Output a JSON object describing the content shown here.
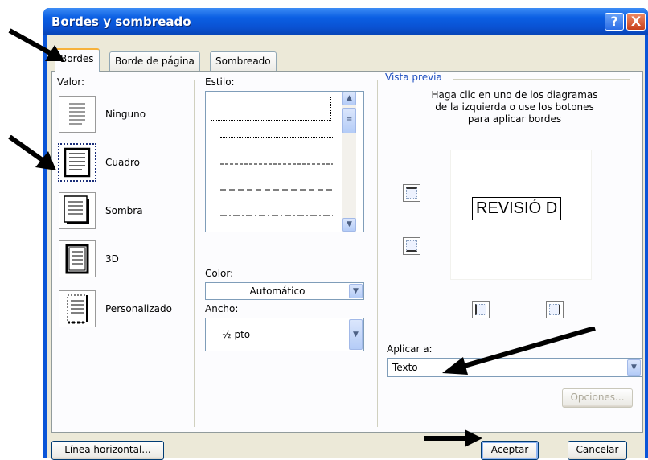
{
  "window": {
    "title": "Bordes y sombreado",
    "help_glyph": "?",
    "close_glyph": "X"
  },
  "tabs": [
    {
      "label": "Bordes",
      "active": true
    },
    {
      "label": "Borde de página",
      "active": false
    },
    {
      "label": "Sombreado",
      "active": false
    }
  ],
  "valor": {
    "label": "Valor:",
    "options": [
      {
        "label": "Ninguno",
        "icon": "border-none-icon",
        "selected": false
      },
      {
        "label": "Cuadro",
        "icon": "border-box-icon",
        "selected": true
      },
      {
        "label": "Sombra",
        "icon": "border-shadow-icon",
        "selected": false
      },
      {
        "label": "3D",
        "icon": "border-3d-icon",
        "selected": false
      },
      {
        "label": "Personalizado",
        "icon": "border-custom-icon",
        "selected": false
      }
    ]
  },
  "estilo": {
    "label": "Estilo:",
    "items": [
      "solid",
      "dotted",
      "dashed-fine",
      "dashed",
      "dash-dot"
    ],
    "selected_index": 0
  },
  "color": {
    "label": "Color:",
    "value": "Automático"
  },
  "ancho": {
    "label": "Ancho:",
    "value": "½ pto"
  },
  "preview": {
    "legend": "Vista previa",
    "instructions": "Haga clic en uno de los diagramas de la izquierda o use los botones para aplicar bordes",
    "sample_text": "REVISIÓ D"
  },
  "aplicar": {
    "label": "Aplicar a:",
    "value": "Texto"
  },
  "buttons": {
    "opciones": "Opciones...",
    "linea_horizontal": "Línea horizontal...",
    "aceptar": "Aceptar",
    "cancelar": "Cancelar"
  },
  "colors": {
    "titlebar": "#0a55d8",
    "dialog_bg": "#ece9d8",
    "active_tab_accent": "#f7b23b",
    "preview_label": "#2050c0"
  }
}
